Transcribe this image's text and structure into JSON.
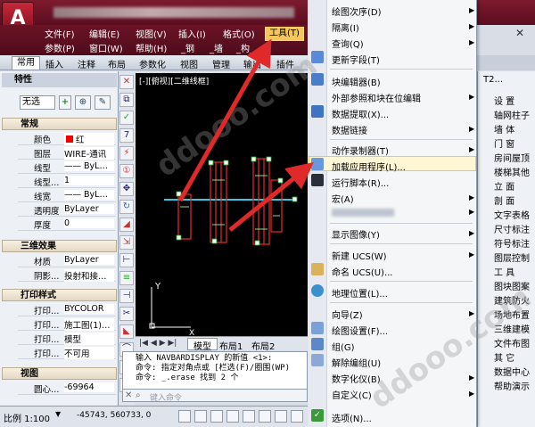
{
  "menubar": {
    "row1": [
      "文件(F)",
      "编辑(E)",
      "视图(V)",
      "插入(I)",
      "格式(O)"
    ],
    "row2": [
      "参数(P)",
      "窗口(W)",
      "帮助(H)",
      "_钢",
      "_墙",
      "_构_"
    ],
    "tools_label": "工具(T)"
  },
  "ribbon": {
    "tabs": [
      "常用",
      "插入",
      "注释",
      "布局",
      "参数化",
      "视图",
      "管理",
      "输出",
      "插件"
    ]
  },
  "properties": {
    "title": "特性",
    "selection": "无选",
    "sections": [
      {
        "title": "常规",
        "rows": [
          {
            "key": "颜色",
            "value": "红"
          },
          {
            "key": "图层",
            "value": "WIRE-通讯"
          },
          {
            "key": "线型",
            "value": "—— ByL…"
          },
          {
            "key": "线型…",
            "value": "1"
          },
          {
            "key": "线宽",
            "value": "—— ByL…"
          },
          {
            "key": "透明度",
            "value": "ByLayer"
          },
          {
            "key": "厚度",
            "value": "0"
          }
        ]
      },
      {
        "title": "三维效果",
        "rows": [
          {
            "key": "材质",
            "value": "ByLayer"
          },
          {
            "key": "阴影…",
            "value": "投射和接…"
          }
        ]
      },
      {
        "title": "打印样式",
        "rows": [
          {
            "key": "打印…",
            "value": "BYCOLOR"
          },
          {
            "key": "打印…",
            "value": "施工图(1)…"
          },
          {
            "key": "打印…",
            "value": "模型"
          },
          {
            "key": "打印…",
            "value": "不可用"
          }
        ]
      },
      {
        "title": "视图",
        "rows": [
          {
            "key": "圆心…",
            "value": "-69964"
          }
        ]
      }
    ]
  },
  "viewport": {
    "label": "[-][俯视][二维线框]",
    "axis_y": "Y",
    "axis_x": "X"
  },
  "model_tabs": [
    "模型",
    "布局1",
    "布局2"
  ],
  "command": {
    "lines": [
      "输入 NAVBARDISPLAY 的新值 <1>:",
      "命令: 指定对角点或 [栏选(F)/圈围(WP)",
      "命令: _.erase 找到 2 个"
    ],
    "placeholder": "键入命令"
  },
  "statusbar": {
    "scale": "比例 1:100",
    "coords": "-45743, 560733, 0"
  },
  "tools_menu": {
    "items": [
      {
        "label": "绘图次序(D)",
        "submenu": true
      },
      {
        "label": "隔离(I)",
        "submenu": true
      },
      {
        "label": "查询(Q)",
        "submenu": true
      },
      {
        "label": "更新字段(T)",
        "submenu": false
      },
      {
        "label": "块编辑器(B)",
        "submenu": false
      },
      {
        "label": "外部参照和块在位编辑",
        "submenu": true
      },
      {
        "label": "数据提取(X)...",
        "submenu": false
      },
      {
        "label": "数据链接",
        "submenu": true
      },
      {
        "label": "动作录制器(T)",
        "submenu": true
      },
      {
        "label": "加载应用程序(L)...",
        "submenu": false
      },
      {
        "label": "运行脚本(R)...",
        "submenu": false
      },
      {
        "label": "宏(A)",
        "submenu": true
      },
      {
        "label": "显示图像(Y)",
        "submenu": true
      },
      {
        "label": "新建 UCS(W)",
        "submenu": true
      },
      {
        "label": "命名 UCS(U)...",
        "submenu": false
      },
      {
        "label": "地理位置(L)...",
        "submenu": false
      },
      {
        "label": "向导(Z)",
        "submenu": true
      },
      {
        "label": "绘图设置(F)...",
        "submenu": false
      },
      {
        "label": "组(G)",
        "submenu": false
      },
      {
        "label": "解除编组(U)",
        "submenu": false
      },
      {
        "label": "数字化仪(B)",
        "submenu": true
      },
      {
        "label": "自定义(C)",
        "submenu": true
      },
      {
        "label": "选项(N)...",
        "submenu": false
      }
    ]
  },
  "right_panel": {
    "header": "T2...",
    "items": [
      "设 置",
      "轴网柱子",
      "墙 体",
      "门 窗",
      "房间屋顶",
      "楼梯其他",
      "立 面",
      "剖 面",
      "文字表格",
      "尺寸标注",
      "符号标注",
      "图层控制",
      "工 具",
      "图块图案",
      "建筑防火",
      "场地布置",
      "三维建模",
      "文件布图",
      "其 它",
      "数据中心",
      "帮助演示"
    ]
  },
  "watermark": "ddooo.com",
  "colors": {
    "accent": "#5a0e1f",
    "highlight": "#f4c75c",
    "arrow": "#e02a2a"
  }
}
